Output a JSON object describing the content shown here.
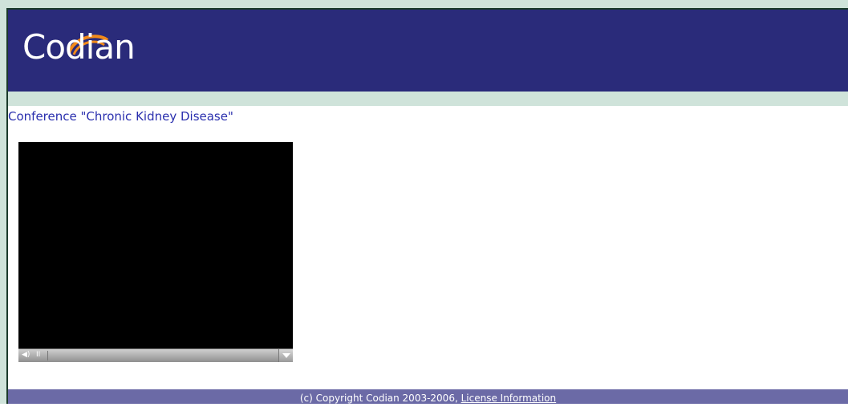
{
  "header": {
    "logo_text": "Codian",
    "logo_arc_color": "#f28a1a",
    "background_color": "#2a2b7a"
  },
  "main": {
    "conference_title": "Conference \"Chronic Kidney Disease\""
  },
  "player": {
    "volume_icon": "speaker-icon",
    "pause_icon": "pause-icon",
    "volume_glyph": "◀)",
    "pause_glyph": "II",
    "menu_icon": "chevron-down-icon"
  },
  "footer": {
    "copyright": "(c) Copyright Codian 2003-2006, ",
    "license_link": "License Information",
    "background_color": "#6b6aa6"
  }
}
